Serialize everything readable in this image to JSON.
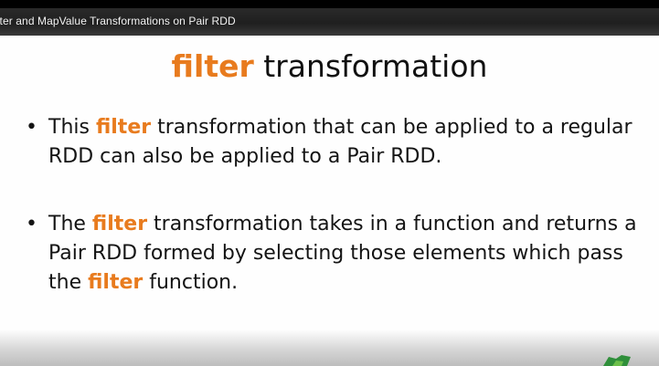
{
  "video": {
    "title": "ilter and MapValue Transformations on Pair RDD"
  },
  "slide": {
    "heading": {
      "keyword": "filter",
      "rest": " transformation"
    },
    "bullets": [
      {
        "marker": "•",
        "line1_pre": "This ",
        "line1_kw": "filter",
        "line1_post": " transformation that can be applied to a regular",
        "line2": "RDD can also be applied to a Pair RDD."
      },
      {
        "marker": "•",
        "line1_pre": "The ",
        "line1_kw": "filter",
        "line1_post": " transformation takes in a function and returns a",
        "line2": "Pair RDD formed by selecting those elements which pass",
        "line3_pre": "the ",
        "line3_kw": "filter",
        "line3_post": " function."
      }
    ]
  },
  "colors": {
    "highlight": "#e87b1e",
    "text": "#141414",
    "title_bar": "#1f1f1f"
  },
  "icons": {
    "corner_logo": "green-logo-icon"
  }
}
